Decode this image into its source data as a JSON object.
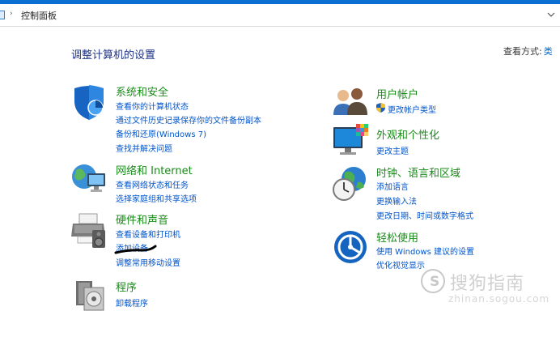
{
  "window": {
    "breadcrumb_sep": "›",
    "address": "控制面板"
  },
  "page": {
    "title": "调整计算机的设置",
    "view_by_label": "查看方式:",
    "view_by_value": "类"
  },
  "left_categories": [
    {
      "icon": "shield-icon",
      "title": "系统和安全",
      "links": [
        "查看你的计算机状态",
        "通过文件历史记录保存你的文件备份副本",
        "备份和还原(Windows 7)",
        "查找并解决问题"
      ]
    },
    {
      "icon": "network-globe-icon",
      "title": "网络和 Internet",
      "links": [
        "查看网络状态和任务",
        "选择家庭组和共享选项"
      ]
    },
    {
      "icon": "printer-icon",
      "title": "硬件和声音",
      "links": [
        "查看设备和打印机",
        "添加设备",
        "调整常用移动设置"
      ]
    },
    {
      "icon": "programs-disc-icon",
      "title": "程序",
      "links": [
        "卸载程序"
      ]
    }
  ],
  "right_categories": [
    {
      "icon": "users-icon",
      "title": "用户帐户",
      "links": [
        "更改帐户类型"
      ]
    },
    {
      "icon": "monitor-palette-icon",
      "title": "外观和个性化",
      "links": [
        "更改主题"
      ]
    },
    {
      "icon": "clock-globe-icon",
      "title": "时钟、语言和区域",
      "links": [
        "添加语言",
        "更换输入法",
        "更改日期、时间或数字格式"
      ]
    },
    {
      "icon": "ease-of-access-icon",
      "title": "轻松使用",
      "links": [
        "使用 Windows 建议的设置",
        "优化视觉显示"
      ]
    }
  ],
  "watermark": {
    "text": "搜狗指南",
    "url": "zhinan.sogou.com"
  }
}
